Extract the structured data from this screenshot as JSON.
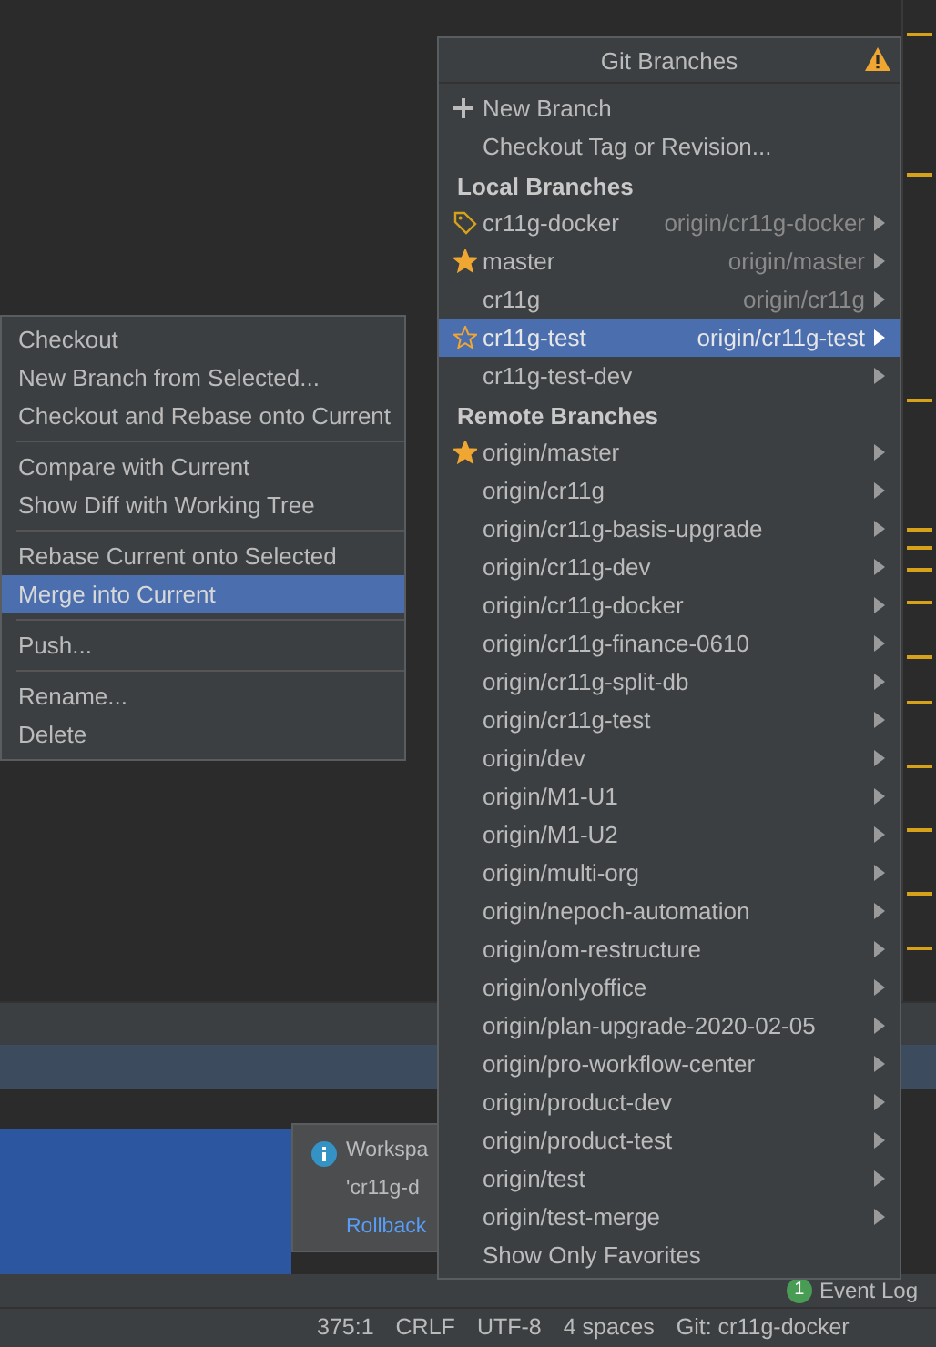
{
  "branches_popup": {
    "title": "Git Branches",
    "actions": [
      {
        "label": "New Branch",
        "kind": "create"
      },
      {
        "label": "Checkout Tag or Revision...",
        "kind": "checkout"
      }
    ],
    "local": {
      "heading": "Local Branches",
      "items": [
        {
          "name": "cr11g-docker",
          "tracking": "origin/cr11g-docker",
          "kind": "current",
          "selected": false
        },
        {
          "name": "master",
          "tracking": "origin/master",
          "kind": "favorite",
          "selected": false
        },
        {
          "name": "cr11g",
          "tracking": "origin/cr11g",
          "selected": false
        },
        {
          "name": "cr11g-test",
          "tracking": "origin/cr11g-test",
          "kind": "hovered",
          "selected": true
        },
        {
          "name": "cr11g-test-dev",
          "selected": false
        }
      ]
    },
    "remote": {
      "heading": "Remote Branches",
      "items": [
        {
          "name": "origin/master",
          "kind": "favorite",
          "selected": false
        },
        {
          "name": "origin/cr11g",
          "selected": false
        },
        {
          "name": "origin/cr11g-basis-upgrade",
          "selected": false
        },
        {
          "name": "origin/cr11g-dev",
          "selected": false
        },
        {
          "name": "origin/cr11g-docker",
          "selected": false
        },
        {
          "name": "origin/cr11g-finance-0610",
          "selected": false
        },
        {
          "name": "origin/cr11g-split-db",
          "selected": false
        },
        {
          "name": "origin/cr11g-test",
          "selected": false
        },
        {
          "name": "origin/dev",
          "selected": false
        },
        {
          "name": "origin/M1-U1",
          "selected": false
        },
        {
          "name": "origin/M1-U2",
          "selected": false
        },
        {
          "name": "origin/multi-org",
          "selected": false
        },
        {
          "name": "origin/nepoch-automation",
          "selected": false
        },
        {
          "name": "origin/om-restructure",
          "selected": false
        },
        {
          "name": "origin/onlyoffice",
          "selected": false
        },
        {
          "name": "origin/plan-upgrade-2020-02-05",
          "selected": false
        },
        {
          "name": "origin/pro-workflow-center",
          "selected": false
        },
        {
          "name": "origin/product-dev",
          "selected": false
        },
        {
          "name": "origin/product-test",
          "selected": false
        },
        {
          "name": "origin/test",
          "selected": false
        },
        {
          "name": "origin/test-merge",
          "selected": false
        }
      ]
    },
    "footer": "Show Only Favorites"
  },
  "context_menu": {
    "groups": [
      [
        {
          "label": "Checkout",
          "selected": false
        },
        {
          "label": "New Branch from Selected...",
          "selected": false
        },
        {
          "label": "Checkout and Rebase onto Current",
          "selected": false
        }
      ],
      [
        {
          "label": "Compare with Current",
          "selected": false
        },
        {
          "label": "Show Diff with Working Tree",
          "selected": false
        }
      ],
      [
        {
          "label": "Rebase Current onto Selected",
          "selected": false
        },
        {
          "label": "Merge into Current",
          "selected": true
        }
      ],
      [
        {
          "label": "Push...",
          "selected": false
        }
      ],
      [
        {
          "label": "Rename...",
          "selected": false
        },
        {
          "label": "Delete",
          "selected": false
        }
      ]
    ]
  },
  "notification": {
    "lines": [
      "Workspa",
      "'cr11g-d"
    ],
    "link": "Rollback"
  },
  "event_log": {
    "badge": "1",
    "label": "Event Log"
  },
  "status_bar": [
    "375:1",
    "CRLF",
    "UTF-8",
    "4 spaces",
    "Git: cr11g-docker"
  ]
}
